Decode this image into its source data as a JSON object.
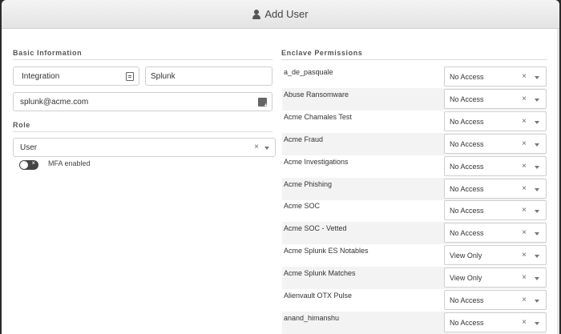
{
  "modal": {
    "title": "Add User"
  },
  "basic": {
    "section_title": "Basic Information",
    "first_name": "Integration",
    "last_name": "Splunk",
    "email": "splunk@acme.com"
  },
  "role": {
    "section_title": "Role",
    "selected": "User",
    "clear": "×"
  },
  "mfa": {
    "label": "MFA enabled",
    "enabled": false,
    "off_glyph": "×"
  },
  "permissions": {
    "section_title": "Enclave Permissions",
    "clear": "×",
    "items": [
      {
        "name": "a_de_pasquale",
        "value": "No Access"
      },
      {
        "name": "Abuse Ransomware",
        "value": "No Access"
      },
      {
        "name": "Acme Chamales Test",
        "value": "No Access"
      },
      {
        "name": "Acme Fraud",
        "value": "No Access"
      },
      {
        "name": "Acme Investigations",
        "value": "No Access"
      },
      {
        "name": "Acme Phishing",
        "value": "No Access"
      },
      {
        "name": "Acme SOC",
        "value": "No Access"
      },
      {
        "name": "Acme SOC - Vetted",
        "value": "No Access"
      },
      {
        "name": "Acme Splunk ES Notables",
        "value": "View Only"
      },
      {
        "name": "Acme Splunk Matches",
        "value": "View Only"
      },
      {
        "name": "Alienvault OTX Pulse",
        "value": "No Access"
      },
      {
        "name": "anand_himanshu",
        "value": "No Access"
      }
    ]
  }
}
